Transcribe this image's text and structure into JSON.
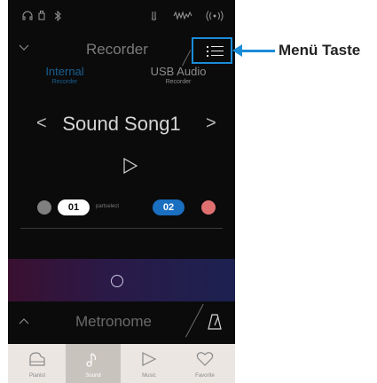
{
  "status_bar": {
    "icons": [
      "headphones-icon",
      "usb-stick-icon",
      "bluetooth-icon",
      "wireless-midi-icon",
      "audio-signal-icon",
      "wifi-icon"
    ]
  },
  "header": {
    "title": "Recorder",
    "menu_icon": "list-icon"
  },
  "tabs": [
    {
      "label": "Internal",
      "sublabel": "Recorder",
      "selected": true
    },
    {
      "label": "USB Audio",
      "sublabel": "Recorder",
      "selected": false
    }
  ],
  "song": {
    "prev": "<",
    "name": "Sound Song1",
    "next": ">"
  },
  "parts": {
    "part1": "01",
    "label": "partselect",
    "part2": "02"
  },
  "metronome": {
    "title": "Metronome"
  },
  "nav": [
    {
      "label": "Pianist",
      "icon": "piano-icon"
    },
    {
      "label": "Sound",
      "icon": "music-note-icon",
      "active": true
    },
    {
      "label": "Music",
      "icon": "play-icon"
    },
    {
      "label": "Favorite",
      "icon": "heart-icon"
    }
  ],
  "callout": {
    "text": "Menü Taste"
  },
  "colors": {
    "accent": "#1a8cd8",
    "part2_pill": "#1a6fc0",
    "part2_ball": "#e07070",
    "part1_ball": "#808080"
  }
}
